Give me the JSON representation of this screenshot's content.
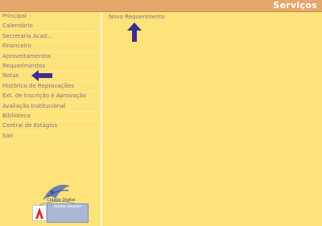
{
  "header": {
    "title": "Serviços"
  },
  "sidebar": {
    "items": [
      {
        "label": "Principal"
      },
      {
        "label": "Calendário"
      },
      {
        "label": "Secretaria Acad..."
      },
      {
        "label": "Financeiro"
      },
      {
        "label": "Aproveitamentos"
      },
      {
        "label": "Requerimentos"
      },
      {
        "label": "Notas"
      },
      {
        "label": "Histórico de Reprovações"
      },
      {
        "label": "Ext. de Inscrição e Aprovação"
      },
      {
        "label": "Avaliação Institucional"
      },
      {
        "label": "Biblioteca"
      },
      {
        "label": "Central de Estágios"
      },
      {
        "label": "Sair"
      }
    ],
    "logo_caption": "Cidade Digital",
    "reader_badge": "Adobe Reader"
  },
  "main": {
    "link_label": "Novo Requerimento"
  },
  "colors": {
    "background": "#fde37a",
    "header_bar": "#e3a86c",
    "link_text": "#8a6f8e",
    "arrow": "#3b2f8c"
  },
  "icons": {
    "sidebar_pointer": "arrow-left-icon",
    "main_pointer": "arrow-up-icon",
    "logo": "institution-logo-icon",
    "adobe": "adobe-logo-icon"
  }
}
